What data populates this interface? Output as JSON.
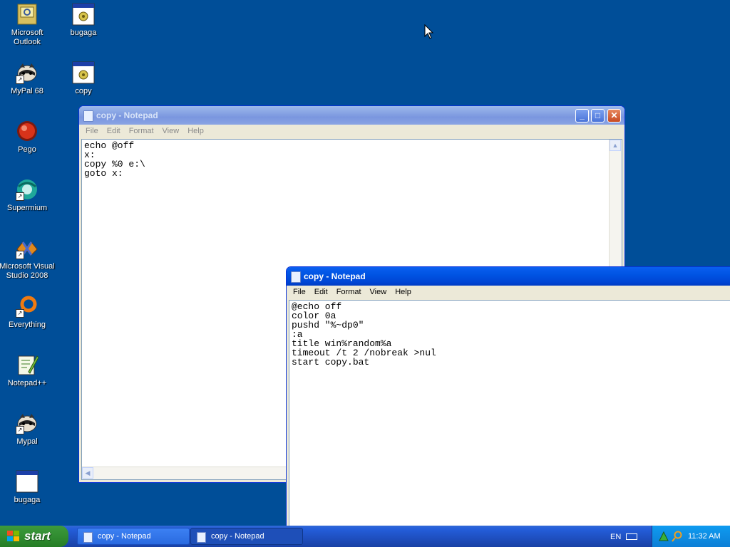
{
  "desktop": {
    "icons": [
      {
        "label": "Microsoft Outlook",
        "icon": "outlook-icon"
      },
      {
        "label": "bugaga",
        "icon": "batch-file-icon"
      },
      {
        "label": "MyPal 68",
        "icon": "mypal-icon"
      },
      {
        "label": "copy",
        "icon": "batch-file-icon"
      },
      {
        "label": "Pego",
        "icon": "pego-icon"
      },
      {
        "label": "Supermium",
        "icon": "supermium-icon"
      },
      {
        "label": "Microsoft Visual Studio 2008",
        "icon": "visual-studio-icon"
      },
      {
        "label": "Everything",
        "icon": "everything-search-icon"
      },
      {
        "label": "Notepad++",
        "icon": "notepadpp-icon"
      },
      {
        "label": "Mypal",
        "icon": "mypal-icon"
      },
      {
        "label": "bugaga",
        "icon": "batch-file-icon"
      }
    ]
  },
  "window1": {
    "title": "copy - Notepad",
    "menu": [
      "File",
      "Edit",
      "Format",
      "View",
      "Help"
    ],
    "lines": [
      "echo @off",
      "x:",
      "copy %0 e:\\",
      "goto x:"
    ]
  },
  "window2": {
    "title": "copy - Notepad",
    "menu": [
      "File",
      "Edit",
      "Format",
      "View",
      "Help"
    ],
    "lines": [
      "@echo off",
      "color 0a",
      "pushd \"%~dp0\"",
      ":a",
      "title win%random%a",
      "timeout /t 2 /nobreak >nul",
      "start copy.bat"
    ]
  },
  "taskbar": {
    "start_label": "start",
    "items": [
      "copy - Notepad",
      "copy - Notepad"
    ],
    "language": "EN",
    "clock": "11:32 AM"
  },
  "colors": {
    "desktop": "#004e98",
    "title_active": "#0054e3",
    "title_inactive": "#7a96df",
    "start_green": "#2f8a2f"
  }
}
